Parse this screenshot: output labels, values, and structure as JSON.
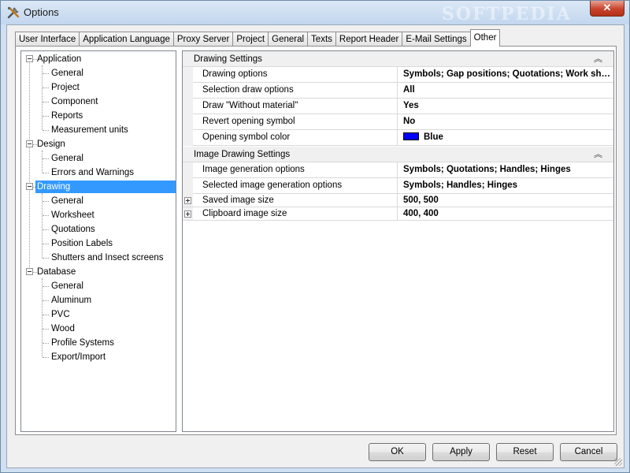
{
  "window": {
    "title": "Options",
    "close_glyph": "✕",
    "watermark": "SOFTPEDIA"
  },
  "tabs": [
    {
      "label": "User Interface"
    },
    {
      "label": "Application Language"
    },
    {
      "label": "Proxy Server"
    },
    {
      "label": "Project"
    },
    {
      "label": "General"
    },
    {
      "label": "Texts"
    },
    {
      "label": "Report Header"
    },
    {
      "label": "E-Mail Settings"
    },
    {
      "label": "Other",
      "active": true
    }
  ],
  "tree": {
    "groups": [
      {
        "label": "Application",
        "children": [
          "General",
          "Project",
          "Component",
          "Reports",
          "Measurement units"
        ]
      },
      {
        "label": "Design",
        "children": [
          "General",
          "Errors and Warnings"
        ]
      },
      {
        "label": "Drawing",
        "selected": true,
        "children": [
          "General",
          "Worksheet",
          "Quotations",
          "Position Labels",
          "Shutters and Insect screens"
        ]
      },
      {
        "label": "Database",
        "children": [
          "General",
          "Aluminum",
          "PVC",
          "Wood",
          "Profile Systems",
          "Export/Import"
        ]
      }
    ]
  },
  "grid": {
    "drawing_settings": {
      "title": "Drawing Settings",
      "collapse_glyph": "︽",
      "rows": [
        {
          "name": "Drawing options",
          "value": "Symbols; Gap positions; Quotations; Work she..."
        },
        {
          "name": "Selection draw options",
          "value": "All"
        },
        {
          "name": "Draw \"Without material\"",
          "value": "Yes"
        },
        {
          "name": "Revert opening symbol",
          "value": "No"
        },
        {
          "name": "Opening symbol color",
          "value": "Blue",
          "color": "#0000ff"
        }
      ]
    },
    "image_settings": {
      "title": "Image Drawing Settings",
      "collapse_glyph": "︽",
      "rows": [
        {
          "name": "Image generation options",
          "value": "Symbols; Quotations; Handles; Hinges"
        },
        {
          "name": "Selected image generation options",
          "value": "Symbols; Handles; Hinges"
        },
        {
          "name": "Saved image size",
          "value": "500, 500",
          "expandable": true
        },
        {
          "name": "Clipboard image size",
          "value": "400, 400",
          "expandable": true
        }
      ]
    }
  },
  "buttons": {
    "ok": "OK",
    "apply": "Apply",
    "reset": "Reset",
    "cancel": "Cancel"
  },
  "colors": {
    "selection": "#3399ff",
    "opening_symbol": "#0000ff"
  }
}
